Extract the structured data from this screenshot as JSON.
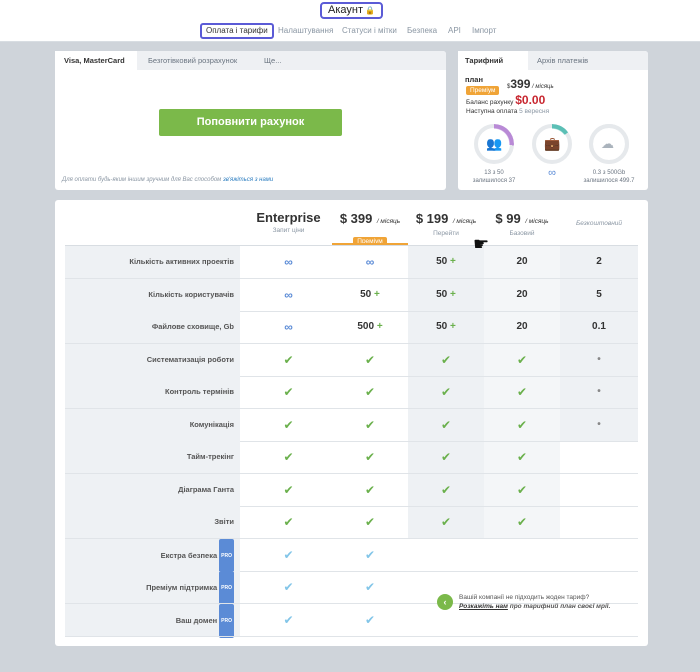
{
  "header": {
    "title": "Акаунт",
    "lock_icon": "lock-icon"
  },
  "subnav": [
    {
      "label": "Оплата і тарифи",
      "active": true
    },
    {
      "label": "Налаштування"
    },
    {
      "label": "Статуси і мітки"
    },
    {
      "label": "Безпека"
    },
    {
      "label": "API"
    },
    {
      "label": "Імпорт"
    }
  ],
  "payment": {
    "tabs": [
      "Visa, MasterCard",
      "Безготівковий розрахунок",
      "Ще..."
    ],
    "topup_button": "Поповнити рахунок",
    "note_text": "Для оплати будь-яким іншим зручним для Вас способом",
    "note_link": "зв'яжіться з нами"
  },
  "plan": {
    "tabs": [
      "Тарифний план",
      "Архів платежів"
    ],
    "badge": "Преміум",
    "price_currency": "$",
    "price_value": "399",
    "price_unit": "/ місяць",
    "balance_label": "Баланс рахунку",
    "balance_value": "$0.00",
    "next_payment_label": "Наступна оплата",
    "next_payment_date": "5 вересня",
    "rings": [
      {
        "icon": "users-icon",
        "line1": "13 з 50",
        "line2": "залишилося 37",
        "color": "#b98ad6",
        "fraction": 0.26
      },
      {
        "icon": "briefcase-icon",
        "line1": "∞",
        "line2": "",
        "color": "#5bbfb5",
        "fraction": 0.15
      },
      {
        "icon": "cloud-icon",
        "line1": "0.3 з 500Gb",
        "line2": "залишилося 499.7",
        "color": "#e6e9ec",
        "fraction": 0.0
      }
    ]
  },
  "pricing": {
    "columns": [
      {
        "name": "Enterprise",
        "sub": "Запит ціни"
      },
      {
        "price": "$ 399",
        "unit": "/ місяць",
        "badge": "Преміум"
      },
      {
        "price": "$ 199",
        "unit": "/ місяць",
        "sub": "Перейти"
      },
      {
        "price": "$ 99",
        "unit": "/ місяць",
        "sub": "Базовий"
      },
      {
        "name": "Безкоштовний"
      }
    ],
    "rows": [
      {
        "label": "Кількість активних проектів",
        "cells": [
          "∞",
          "∞",
          "50 +",
          "20",
          "2"
        ]
      },
      {
        "label": "Кількість користувачів",
        "cells": [
          "∞",
          "50 +",
          "50 +",
          "20",
          "5"
        ]
      },
      {
        "label": "Файлове сховище, Gb",
        "cells": [
          "∞",
          "500 +",
          "50 +",
          "20",
          "0.1"
        ]
      },
      {
        "label": "Систематизація роботи",
        "cells": [
          "✔",
          "✔",
          "✔",
          "✔",
          "•"
        ]
      },
      {
        "label": "Контроль термінів",
        "cells": [
          "✔",
          "✔",
          "✔",
          "✔",
          "•"
        ]
      },
      {
        "label": "Комунікація",
        "cells": [
          "✔",
          "✔",
          "✔",
          "✔",
          "•"
        ]
      },
      {
        "label": "Тайм-трекінг",
        "cells": [
          "✔",
          "✔",
          "✔",
          "✔",
          ""
        ]
      },
      {
        "label": "Діаграма Ганта",
        "cells": [
          "✔",
          "✔",
          "✔",
          "✔",
          ""
        ]
      },
      {
        "label": "Звіти",
        "cells": [
          "✔",
          "✔",
          "✔",
          "✔",
          ""
        ]
      },
      {
        "label": "Екстра безпека",
        "pro": "PRO",
        "cells": [
          "✔",
          "✔",
          "",
          "",
          ""
        ]
      },
      {
        "label": "Преміум підтримка",
        "pro": "PRO",
        "cells": [
          "✔",
          "✔",
          "",
          "",
          ""
        ]
      },
      {
        "label": "Ваш домен",
        "pro": "PRO",
        "cells": [
          "✔",
          "✔",
          "",
          "",
          ""
        ]
      }
    ],
    "cta_line1": "Вашій компанії не підходить жоден тариф?",
    "cta_link": "Розкажіть нам",
    "cta_line2_rest": " про тарифний план своєї мрії."
  }
}
